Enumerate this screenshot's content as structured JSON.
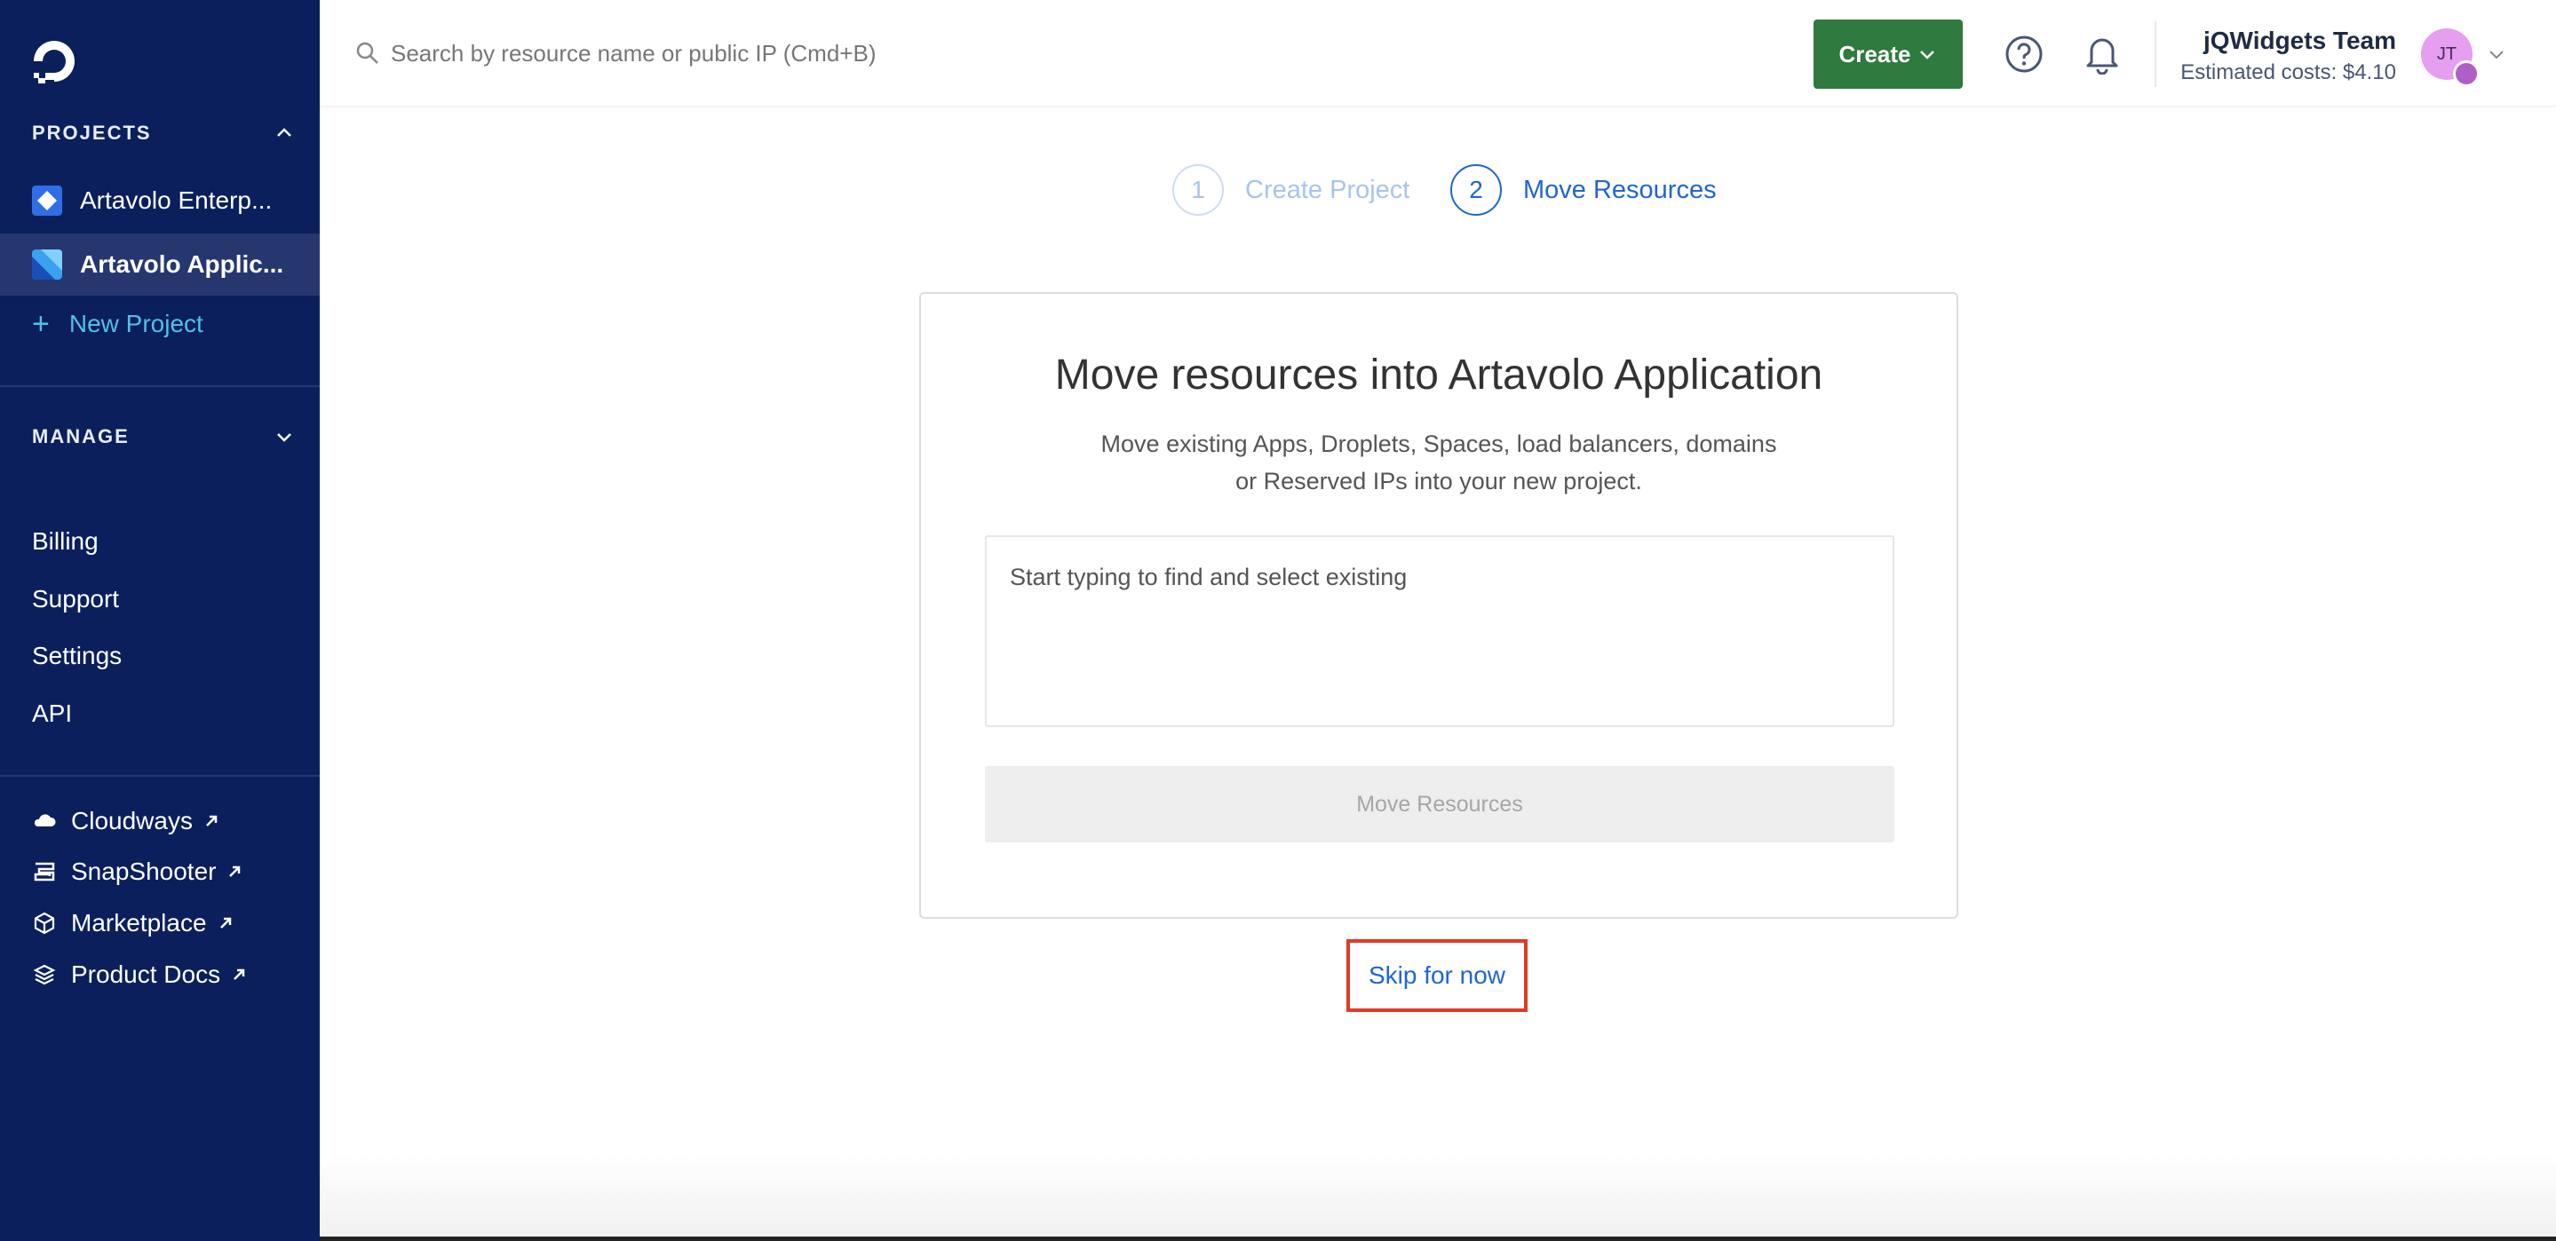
{
  "sidebar": {
    "projects_heading": "PROJECTS",
    "projects": [
      {
        "label": "Artavolo Enterp...",
        "icon": "diamond-project-icon",
        "color": "#2f6fe6"
      },
      {
        "label": "Artavolo Applic...",
        "icon": "slash-project-icon",
        "color": "#3aa0f0",
        "active": true
      }
    ],
    "new_project_label": "New Project",
    "manage_heading": "MANAGE",
    "manage_links": [
      "Billing",
      "Support",
      "Settings",
      "API"
    ],
    "external_links": [
      {
        "label": "Cloudways",
        "icon": "cloud-icon"
      },
      {
        "label": "SnapShooter",
        "icon": "snapshooter-icon"
      },
      {
        "label": "Marketplace",
        "icon": "cube-icon"
      },
      {
        "label": "Product Docs",
        "icon": "layers-icon"
      }
    ]
  },
  "topbar": {
    "search_placeholder": "Search by resource name or public IP (Cmd+B)",
    "create_label": "Create",
    "team_name": "jQWidgets Team",
    "estimated_costs": "Estimated costs: $4.10",
    "avatar_initials": "JT"
  },
  "stepper": {
    "steps": [
      {
        "number": "1",
        "label": "Create Project",
        "state": "inactive"
      },
      {
        "number": "2",
        "label": "Move Resources",
        "state": "active"
      }
    ]
  },
  "card": {
    "title": "Move resources into Artavolo Application",
    "description": "Move existing Apps, Droplets, Spaces, load balancers, domains or Reserved IPs into your new project.",
    "field_placeholder": "Start typing to find and select existing",
    "move_button_label": "Move Resources"
  },
  "skip_label": "Skip for now",
  "colors": {
    "sidebar_bg": "#0b1f5c",
    "create_button": "#2f7a3e",
    "accent_blue": "#1f66d1",
    "highlight_box": "#e03a26"
  }
}
